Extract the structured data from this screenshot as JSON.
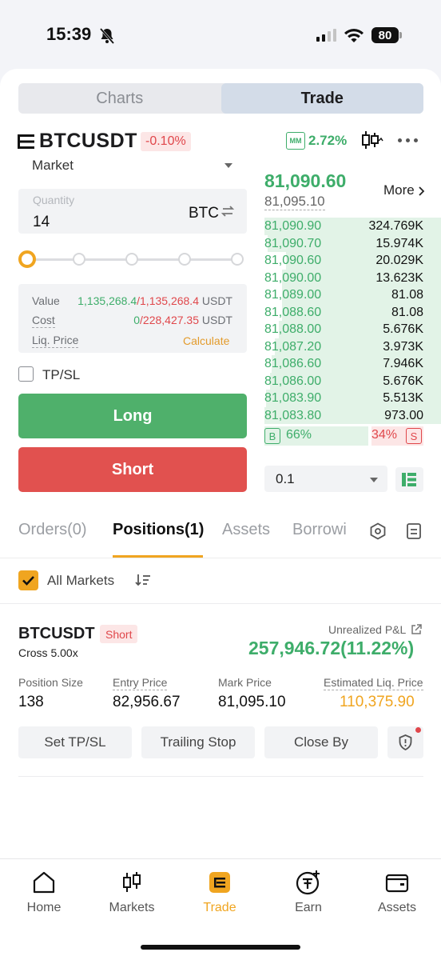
{
  "status": {
    "time": "15:39",
    "battery": "80"
  },
  "segments": {
    "charts": "Charts",
    "trade": "Trade"
  },
  "header": {
    "symbol": "BTCUSDT",
    "change": "-0.10%",
    "mm_label": "MM",
    "mm_value": "2.72%"
  },
  "order_form": {
    "order_type": "Market",
    "quantity_label": "Quantity",
    "quantity_value": "14",
    "quantity_unit": "BTC",
    "slider_level_percent": 0,
    "value_label": "Value",
    "value_green": "1,135,268.4",
    "value_red": "1,135,268.4",
    "value_unit": "USDT",
    "cost_label": "Cost",
    "cost_green": "0",
    "cost_red": "228,427.35",
    "cost_unit": "USDT",
    "liq_label": "Liq. Price",
    "liq_action": "Calculate",
    "tpsl_label": "TP/SL",
    "long_label": "Long",
    "short_label": "Short"
  },
  "order_book": {
    "last_price": "81,090.60",
    "mark_price": "81,095.10",
    "more_label": "More",
    "rows": [
      {
        "price": "81,090.90",
        "qty": "324.769K",
        "depth": 1.0
      },
      {
        "price": "81,090.70",
        "qty": "15.974K",
        "depth": 0.98
      },
      {
        "price": "81,090.60",
        "qty": "20.029K",
        "depth": 0.88
      },
      {
        "price": "81,090.00",
        "qty": "13.623K",
        "depth": 0.9
      },
      {
        "price": "81,089.00",
        "qty": "81.08",
        "depth": 0.9
      },
      {
        "price": "81,088.60",
        "qty": "81.08",
        "depth": 0.9
      },
      {
        "price": "81,088.00",
        "qty": "5.676K",
        "depth": 0.92
      },
      {
        "price": "81,087.20",
        "qty": "3.973K",
        "depth": 0.94
      },
      {
        "price": "81,086.60",
        "qty": "7.946K",
        "depth": 0.96
      },
      {
        "price": "81,086.00",
        "qty": "5.676K",
        "depth": 0.97
      },
      {
        "price": "81,083.90",
        "qty": "5.513K",
        "depth": 0.99
      },
      {
        "price": "81,083.80",
        "qty": "973.00",
        "depth": 1.0
      }
    ],
    "buy_label": "B",
    "buy_pct": "66%",
    "sell_pct": "34%",
    "sell_label": "S",
    "depth_value": "0.1"
  },
  "tabs": {
    "orders": "Orders(0)",
    "positions": "Positions(1)",
    "assets": "Assets",
    "borrowing": "Borrowi"
  },
  "filter": {
    "all_markets": "All Markets"
  },
  "position": {
    "symbol": "BTCUSDT",
    "side": "Short",
    "margin": "Cross 5.00x",
    "upl_label": "Unrealized P&L",
    "upl_value": "257,946.72(11.22%)",
    "size_label": "Position Size",
    "size_value": "138",
    "entry_label": "Entry Price",
    "entry_value": "82,956.67",
    "mark_label": "Mark Price",
    "mark_value": "81,095.10",
    "liq_label": "Estimated Liq. Price",
    "liq_value": "110,375.90",
    "btn_tpsl": "Set TP/SL",
    "btn_trailing": "Trailing Stop",
    "btn_close": "Close By"
  },
  "nav": {
    "home": "Home",
    "markets": "Markets",
    "trade": "Trade",
    "earn": "Earn",
    "assets": "Assets"
  },
  "colors": {
    "green": "#3ead6a",
    "red": "#e0474b",
    "accent": "#f0a520"
  }
}
